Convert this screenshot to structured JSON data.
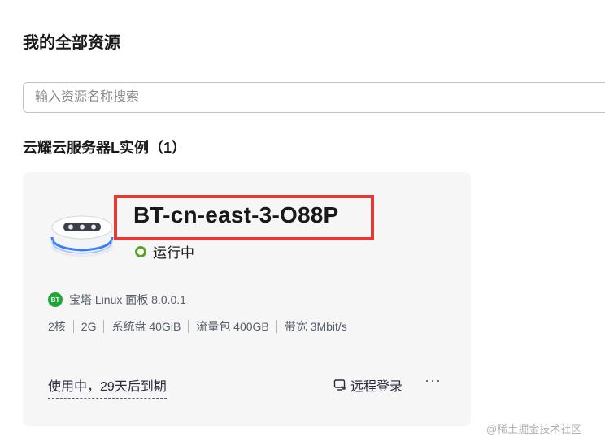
{
  "page": {
    "title": "我的全部资源"
  },
  "search": {
    "placeholder": "输入资源名称搜索",
    "value": ""
  },
  "section": {
    "title": "云耀云服务器L实例（1）"
  },
  "instance": {
    "name": "BT-cn-east-3-O88P",
    "status": "运行中",
    "status_color": "#5ba023",
    "image": {
      "badge": "BT",
      "label": "宝塔 Linux 面板 8.0.0.1",
      "badge_color": "#20a53a"
    },
    "specs": [
      "2核",
      "2G",
      "系统盘 40GiB",
      "流量包 400GB",
      "带宽 3Mbit/s"
    ],
    "expiry": "使用中，29天后到期",
    "actions": {
      "remote_login": "远程登录",
      "more": "···"
    },
    "highlight_color": "#e53935"
  },
  "watermark": "@稀土掘金技术社区"
}
